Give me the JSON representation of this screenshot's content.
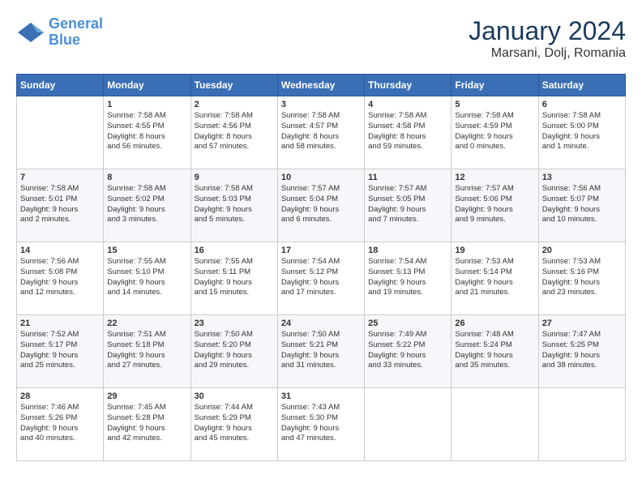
{
  "header": {
    "logo_line1": "General",
    "logo_line2": "Blue",
    "month": "January 2024",
    "location": "Marsani, Dolj, Romania"
  },
  "weekdays": [
    "Sunday",
    "Monday",
    "Tuesday",
    "Wednesday",
    "Thursday",
    "Friday",
    "Saturday"
  ],
  "weeks": [
    [
      {
        "day": "",
        "info": ""
      },
      {
        "day": "1",
        "info": "Sunrise: 7:58 AM\nSunset: 4:55 PM\nDaylight: 8 hours\nand 56 minutes."
      },
      {
        "day": "2",
        "info": "Sunrise: 7:58 AM\nSunset: 4:56 PM\nDaylight: 8 hours\nand 57 minutes."
      },
      {
        "day": "3",
        "info": "Sunrise: 7:58 AM\nSunset: 4:57 PM\nDaylight: 8 hours\nand 58 minutes."
      },
      {
        "day": "4",
        "info": "Sunrise: 7:58 AM\nSunset: 4:58 PM\nDaylight: 8 hours\nand 59 minutes."
      },
      {
        "day": "5",
        "info": "Sunrise: 7:58 AM\nSunset: 4:59 PM\nDaylight: 9 hours\nand 0 minutes."
      },
      {
        "day": "6",
        "info": "Sunrise: 7:58 AM\nSunset: 5:00 PM\nDaylight: 9 hours\nand 1 minute."
      }
    ],
    [
      {
        "day": "7",
        "info": "Sunrise: 7:58 AM\nSunset: 5:01 PM\nDaylight: 9 hours\nand 2 minutes."
      },
      {
        "day": "8",
        "info": "Sunrise: 7:58 AM\nSunset: 5:02 PM\nDaylight: 9 hours\nand 3 minutes."
      },
      {
        "day": "9",
        "info": "Sunrise: 7:58 AM\nSunset: 5:03 PM\nDaylight: 9 hours\nand 5 minutes."
      },
      {
        "day": "10",
        "info": "Sunrise: 7:57 AM\nSunset: 5:04 PM\nDaylight: 9 hours\nand 6 minutes."
      },
      {
        "day": "11",
        "info": "Sunrise: 7:57 AM\nSunset: 5:05 PM\nDaylight: 9 hours\nand 7 minutes."
      },
      {
        "day": "12",
        "info": "Sunrise: 7:57 AM\nSunset: 5:06 PM\nDaylight: 9 hours\nand 9 minutes."
      },
      {
        "day": "13",
        "info": "Sunrise: 7:56 AM\nSunset: 5:07 PM\nDaylight: 9 hours\nand 10 minutes."
      }
    ],
    [
      {
        "day": "14",
        "info": "Sunrise: 7:56 AM\nSunset: 5:08 PM\nDaylight: 9 hours\nand 12 minutes."
      },
      {
        "day": "15",
        "info": "Sunrise: 7:55 AM\nSunset: 5:10 PM\nDaylight: 9 hours\nand 14 minutes."
      },
      {
        "day": "16",
        "info": "Sunrise: 7:55 AM\nSunset: 5:11 PM\nDaylight: 9 hours\nand 15 minutes."
      },
      {
        "day": "17",
        "info": "Sunrise: 7:54 AM\nSunset: 5:12 PM\nDaylight: 9 hours\nand 17 minutes."
      },
      {
        "day": "18",
        "info": "Sunrise: 7:54 AM\nSunset: 5:13 PM\nDaylight: 9 hours\nand 19 minutes."
      },
      {
        "day": "19",
        "info": "Sunrise: 7:53 AM\nSunset: 5:14 PM\nDaylight: 9 hours\nand 21 minutes."
      },
      {
        "day": "20",
        "info": "Sunrise: 7:53 AM\nSunset: 5:16 PM\nDaylight: 9 hours\nand 23 minutes."
      }
    ],
    [
      {
        "day": "21",
        "info": "Sunrise: 7:52 AM\nSunset: 5:17 PM\nDaylight: 9 hours\nand 25 minutes."
      },
      {
        "day": "22",
        "info": "Sunrise: 7:51 AM\nSunset: 5:18 PM\nDaylight: 9 hours\nand 27 minutes."
      },
      {
        "day": "23",
        "info": "Sunrise: 7:50 AM\nSunset: 5:20 PM\nDaylight: 9 hours\nand 29 minutes."
      },
      {
        "day": "24",
        "info": "Sunrise: 7:50 AM\nSunset: 5:21 PM\nDaylight: 9 hours\nand 31 minutes."
      },
      {
        "day": "25",
        "info": "Sunrise: 7:49 AM\nSunset: 5:22 PM\nDaylight: 9 hours\nand 33 minutes."
      },
      {
        "day": "26",
        "info": "Sunrise: 7:48 AM\nSunset: 5:24 PM\nDaylight: 9 hours\nand 35 minutes."
      },
      {
        "day": "27",
        "info": "Sunrise: 7:47 AM\nSunset: 5:25 PM\nDaylight: 9 hours\nand 38 minutes."
      }
    ],
    [
      {
        "day": "28",
        "info": "Sunrise: 7:46 AM\nSunset: 5:26 PM\nDaylight: 9 hours\nand 40 minutes."
      },
      {
        "day": "29",
        "info": "Sunrise: 7:45 AM\nSunset: 5:28 PM\nDaylight: 9 hours\nand 42 minutes."
      },
      {
        "day": "30",
        "info": "Sunrise: 7:44 AM\nSunset: 5:29 PM\nDaylight: 9 hours\nand 45 minutes."
      },
      {
        "day": "31",
        "info": "Sunrise: 7:43 AM\nSunset: 5:30 PM\nDaylight: 9 hours\nand 47 minutes."
      },
      {
        "day": "",
        "info": ""
      },
      {
        "day": "",
        "info": ""
      },
      {
        "day": "",
        "info": ""
      }
    ]
  ]
}
